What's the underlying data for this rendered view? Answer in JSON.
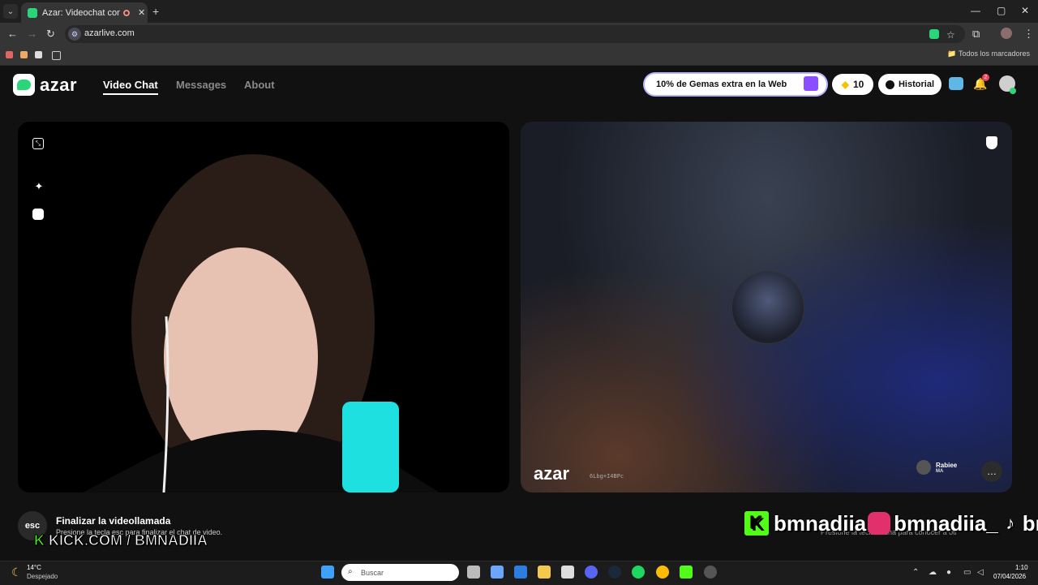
{
  "browser": {
    "tab_title": "Azar: Videochat con gente",
    "tab_close": "✕",
    "newtab": "+",
    "url": "azarlive.com",
    "all_bookmarks": "Todos los marcadores",
    "win_min": "—",
    "win_max": "▢",
    "win_close": "✕",
    "back": "←",
    "forward": "→",
    "reload": "↻",
    "star": "☆",
    "extensions": "⧉",
    "menu": "⋮"
  },
  "app": {
    "logo_text": "azar",
    "nav": [
      "Video Chat",
      "Messages",
      "About"
    ],
    "promo": "10% de Gemas extra en la Web",
    "gems": "10",
    "history": "Historial",
    "notif_count": "2"
  },
  "call": {
    "watermark": "azar",
    "watermark_code": "6Lbg+I4BPc",
    "peer_name": "Rabiee",
    "peer_country": "MA"
  },
  "hint": {
    "esc": "esc",
    "title": "Finalizar la videollamada",
    "subtitle": "Presione la tecla esc para finalizar el chat de video.",
    "right": "Presione la tecla flecha para conocer a otr"
  },
  "overlay": {
    "kick_k": "K",
    "kick_text": "KICK.COM / BMNADIIA",
    "social_k": "K",
    "social_1": "bmnadiia",
    "social_2": "bmnadiia_",
    "social_3": "bmr"
  },
  "taskbar": {
    "temp": "14°C",
    "weather": "Despejado",
    "search_placeholder": "Buscar",
    "time": "1:10",
    "date": "07/04/2026"
  },
  "colors": {
    "brand": "#2bd67b",
    "kick": "#53fc18",
    "promo_outline": "#b8b3ff"
  }
}
